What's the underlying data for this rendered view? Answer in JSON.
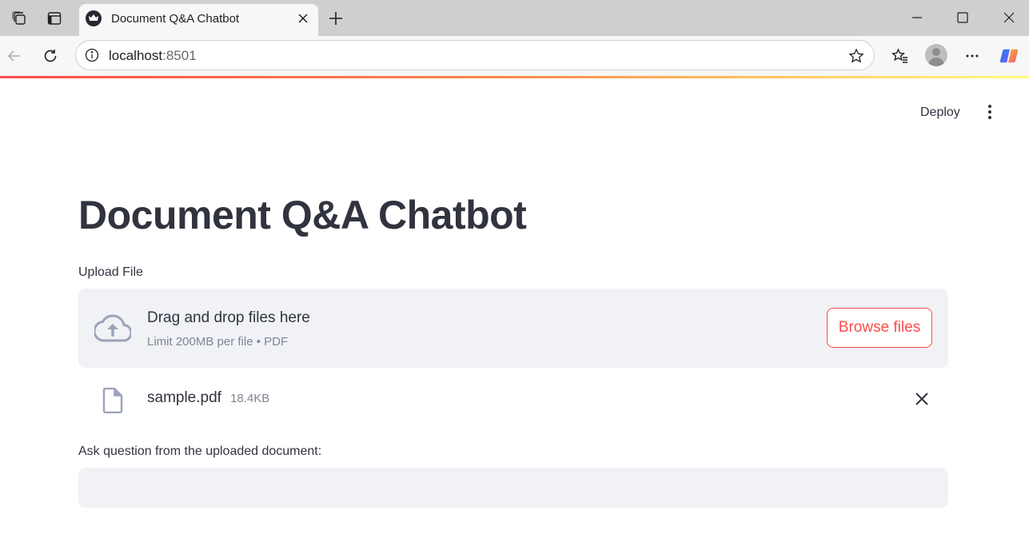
{
  "browser": {
    "tab_title": "Document Q&A Chatbot",
    "url_host": "localhost",
    "url_port": ":8501",
    "icons": {
      "workspaces": "workspaces-icon",
      "tab_actions": "vertical-tabs-icon",
      "favicon": "streamlit-crown-icon",
      "close_tab": "close-icon",
      "new_tab": "plus-icon",
      "minimize": "minimize-icon",
      "maximize": "maximize-icon",
      "close_window": "close-icon",
      "back": "back-arrow-icon",
      "refresh": "refresh-icon",
      "site_info": "info-icon",
      "favorite": "star-icon",
      "favorites": "favorites-icon",
      "profile": "avatar",
      "more": "ellipsis-icon",
      "copilot": "copilot-icon"
    }
  },
  "app": {
    "deploy_label": "Deploy",
    "title": "Document Q&A Chatbot",
    "uploader": {
      "label": "Upload File",
      "drop_text": "Drag and drop files here",
      "limit_text": "Limit 200MB per file • PDF",
      "browse_label": "Browse files"
    },
    "uploaded_file": {
      "name": "sample.pdf",
      "size": "18.4KB"
    },
    "question": {
      "label": "Ask question from the uploaded document:",
      "value": "",
      "placeholder": ""
    },
    "colors": {
      "accent": "#ff4b4b",
      "text": "#31333f",
      "muted": "#808495",
      "input_bg": "#f0f2f6"
    }
  }
}
